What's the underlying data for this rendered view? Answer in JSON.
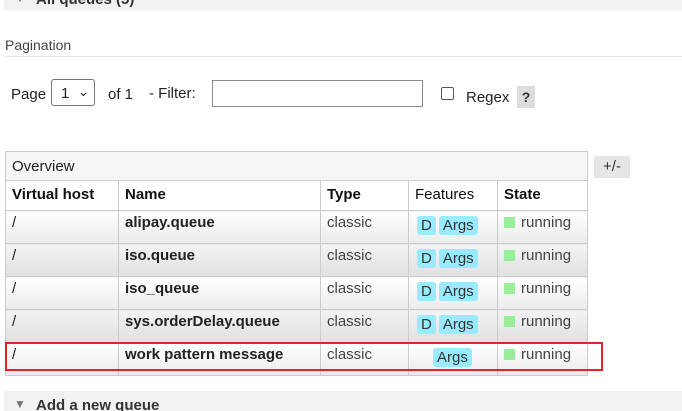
{
  "all_queues_section": {
    "arrow": "▼",
    "title": "All queues (5)"
  },
  "pagination": {
    "title": "Pagination",
    "page_label": "Page",
    "page_value": "1",
    "of_label": "of 1",
    "filter_label": "- Filter:",
    "filter_value": "",
    "regex_label": "Regex",
    "regex_checked": false,
    "help_label": "?"
  },
  "table": {
    "overview_label": "Overview",
    "plus_minus_label": "+/-",
    "columns": [
      "Virtual host",
      "Name",
      "Type",
      "Features",
      "State"
    ],
    "rows": [
      {
        "vhost": "/",
        "name": "alipay.queue",
        "type": "classic",
        "features": [
          "D",
          "Args"
        ],
        "state": "running"
      },
      {
        "vhost": "/",
        "name": "iso.queue",
        "type": "classic",
        "features": [
          "D",
          "Args"
        ],
        "state": "running"
      },
      {
        "vhost": "/",
        "name": "iso_queue",
        "type": "classic",
        "features": [
          "D",
          "Args"
        ],
        "state": "running"
      },
      {
        "vhost": "/",
        "name": "sys.orderDelay.queue",
        "type": "classic",
        "features": [
          "D",
          "Args"
        ],
        "state": "running"
      },
      {
        "vhost": "/",
        "name": "work pattern message",
        "type": "classic",
        "features": [
          "Args"
        ],
        "state": "running"
      }
    ]
  },
  "add_queue_section": {
    "arrow": "▼",
    "title": "Add a new queue"
  },
  "colors": {
    "feature_badge": "#99ebff",
    "running_indicator": "#99ee99",
    "highlight_border": "#e0242a"
  },
  "highlighted_row": 4
}
